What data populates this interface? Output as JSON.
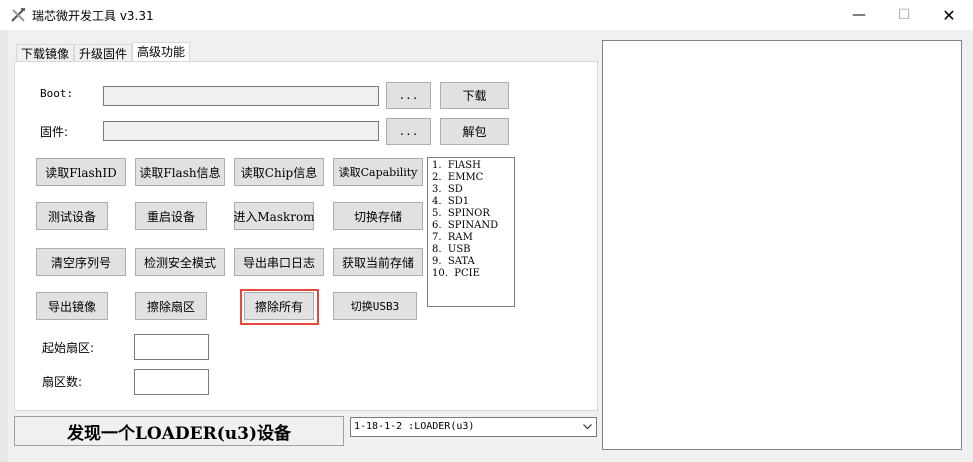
{
  "window": {
    "title": "瑞芯微开发工具 v3.31",
    "minimize_glyph": "—",
    "maximize_glyph": "☐",
    "close_glyph": "✕"
  },
  "tabs": [
    {
      "label": "下载镜像",
      "active": false
    },
    {
      "label": "升级固件",
      "active": false
    },
    {
      "label": "高级功能",
      "active": true
    }
  ],
  "fields": {
    "boot_label": "Boot:",
    "boot_value": "",
    "firmware_label": "固件:",
    "firmware_value": "",
    "browse_label": "...",
    "download_label": "下载",
    "unpack_label": "解包",
    "start_sector_label": "起始扇区:",
    "start_sector_value": "",
    "sector_count_label": "扇区数:",
    "sector_count_value": ""
  },
  "buttons": {
    "read_flash_id": "读取FlashID",
    "read_flash_info": "读取Flash信息",
    "read_chip_info": "读取Chip信息",
    "read_capability": "读取Capability",
    "test_device": "测试设备",
    "reset_device": "重启设备",
    "enter_maskrom": "进入Maskrom",
    "switch_storage": "切换存储",
    "clear_serial": "清空序列号",
    "check_secure_mode": "检测安全模式",
    "export_serial_log": "导出串口日志",
    "get_current_storage": "获取当前存储",
    "export_image": "导出镜像",
    "erase_sectors": "擦除扇区",
    "erase_all": "擦除所有",
    "switch_usb3": "切换USB3"
  },
  "storage_list": [
    "1.  FlASH",
    "2.  EMMC",
    "3.  SD",
    "4.  SD1",
    "5.  SPINOR",
    "6.  SPINAND",
    "7.  RAM",
    "8.  USB",
    "9.  SATA",
    "10.  PCIE"
  ],
  "status": {
    "text": "发现一个LOADER(u3)设备"
  },
  "device_select": {
    "value": "1-18-1-2 :LOADER(u3)"
  },
  "colors": {
    "highlight": "#e8483c"
  }
}
